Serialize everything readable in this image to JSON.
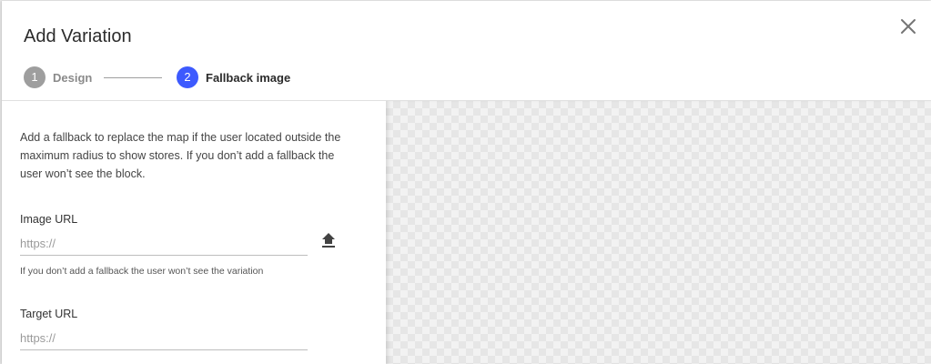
{
  "dialog": {
    "title": "Add Variation"
  },
  "stepper": {
    "steps": [
      {
        "number": "1",
        "label": "Design"
      },
      {
        "number": "2",
        "label": "Fallback image"
      }
    ]
  },
  "form": {
    "description": "Add a fallback to replace the map if the user located outside the maximum radius to show stores. If you don’t add a fallback the user won’t see the block.",
    "image_url": {
      "label": "Image URL",
      "placeholder": "https://",
      "value": "",
      "helper": "If you don’t add a fallback the user won’t see the variation"
    },
    "target_url": {
      "label": "Target URL",
      "placeholder": "https://",
      "value": ""
    }
  },
  "icons": {
    "close": "close-icon",
    "upload": "upload-icon"
  },
  "colors": {
    "active_step": "#3d5afe",
    "inactive_step": "#9e9e9e"
  }
}
